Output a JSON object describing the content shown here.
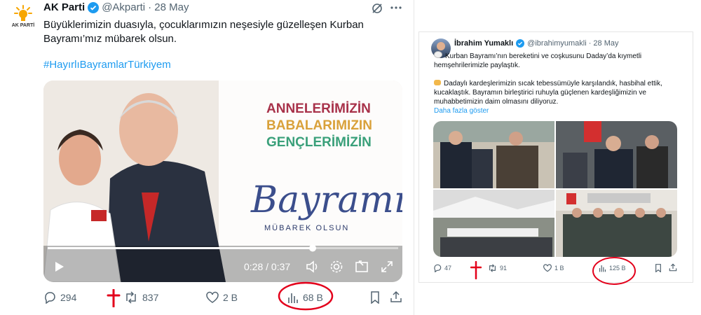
{
  "tweet1": {
    "name": "AK Parti",
    "handle": "@Akparti",
    "date": "· 28 May",
    "logo_text": "AK PARTİ",
    "text_line1": "Büyüklerimizin duasıyla, çocuklarımızın neşesiyle güzelleşen Kurban",
    "text_line2": "Bayramı’mız mübarek olsun.",
    "hashtag": "#HayırlıBayramlarTürkiyem",
    "media": {
      "line1": "ANNELERİMİZİN",
      "line2": "BABALARIMIZIN",
      "line3": "GENÇLERİMİZİN",
      "script": "Bayramı",
      "subtitle": "MÜBAREK OLSUN",
      "time": "0:28 / 0:37",
      "progress": 0.757,
      "badge": "AK"
    },
    "replies": "294",
    "reposts": "837",
    "likes": "2 B",
    "views": "68 B"
  },
  "tweet2": {
    "name": "İbrahim Yumaklı",
    "handle": "@ibrahimyumakli",
    "date": "· 28 May",
    "para1_line1": "Kurban Bayramı’nın bereketini ve coşkusunu Daday’da kıymetli",
    "para1_line2": "hemşehrilerimizle paylaştık.",
    "para2_line1": "Dadaylı kardeşlerimizin sıcak tebessümüyle karşılandık, hasbihal ettik,",
    "para2_line2": "kucaklaştık. Bayramın birleştirici ruhuyla güçlenen kardeşliğimizin ve",
    "para2_line3": "muhabbetimizin daim olmasını diliyoruz.",
    "show_more": "Daha fazla göster",
    "replies": "47",
    "reposts": "91",
    "likes": "1 B",
    "views": "125 B"
  },
  "colors": {
    "accent": "#1d9bf0",
    "annotation": "#e3001b",
    "muted": "#536471"
  }
}
